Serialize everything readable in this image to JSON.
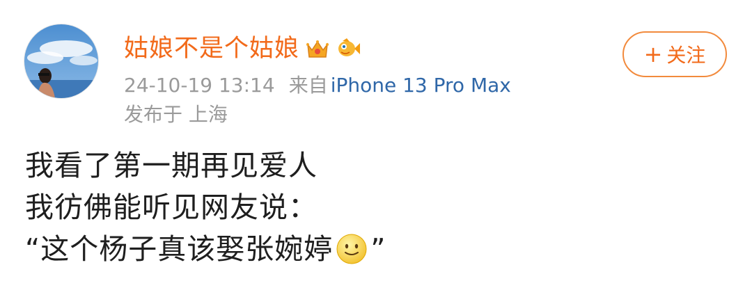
{
  "post": {
    "author": {
      "name": "姑娘不是个姑娘",
      "avatar_icon": "avatar-photo",
      "badges": [
        "crown-badge-icon",
        "fish-badge-icon"
      ]
    },
    "meta": {
      "timestamp": "24-10-19 13:14",
      "from_label": "来自",
      "device": "iPhone 13 Pro Max",
      "location": "发布于 上海"
    },
    "follow_button": {
      "icon": "+",
      "label": "关注"
    },
    "content": {
      "line1": "我看了第一期再见爱人",
      "line2": "我彷佛能听见网友说：",
      "line3_prefix": "“这个杨子真该娶张婉婷",
      "line3_emoji": "smile-emoji-icon",
      "line3_suffix": "”"
    },
    "colors": {
      "username": "#f26a1a",
      "device_link": "#2f67a8",
      "meta_gray": "#9a9a9a",
      "follow_border": "#f28a3c",
      "body_text": "#1e1e1e"
    }
  }
}
